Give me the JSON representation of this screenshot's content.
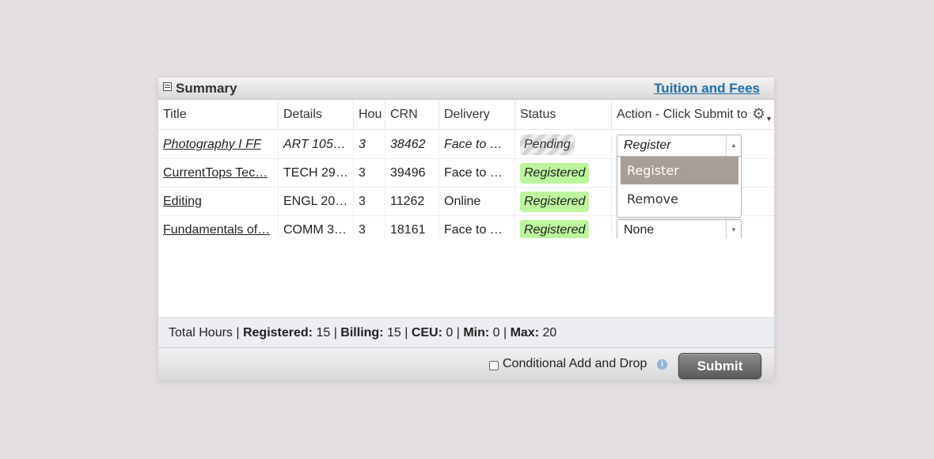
{
  "panel": {
    "title": "Summary",
    "tuition_link": "Tuition and Fees"
  },
  "columns": [
    "Title",
    "Details",
    "Hou",
    "CRN",
    "Delivery",
    "Status",
    "Action - Click Submit to"
  ],
  "rows": [
    {
      "title": "Photography I FF",
      "details": "ART 105…",
      "hours": "3",
      "crn": "38462",
      "delivery": "Face to …",
      "status": "Pending",
      "action": "Register",
      "pending": true
    },
    {
      "title": "CurrentTops Tec…",
      "details": "TECH 29…",
      "hours": "3",
      "crn": "39496",
      "delivery": "Face to …",
      "status": "Registered",
      "action": "",
      "pending": false
    },
    {
      "title": "Editing",
      "details": "ENGL 20…",
      "hours": "3",
      "crn": "11262",
      "delivery": "Online",
      "status": "Registered",
      "action": "",
      "pending": false
    },
    {
      "title": "Fundamentals of…",
      "details": "COMM 3…",
      "hours": "3",
      "crn": "18161",
      "delivery": "Face to …",
      "status": "Registered",
      "action": "None",
      "pending": false
    }
  ],
  "dropdown": {
    "options": [
      "Register",
      "Remove"
    ],
    "selected": "Register"
  },
  "totals": {
    "prefix": "Total Hours | ",
    "registered_label": "Registered:",
    "registered_value": " 15 | ",
    "billing_label": "Billing:",
    "billing_value": " 15 | ",
    "ceu_label": "CEU:",
    "ceu_value": " 0 | ",
    "min_label": "Min:",
    "min_value": " 0 | ",
    "max_label": "Max:",
    "max_value": " 20"
  },
  "footer": {
    "conditional_label": "Conditional Add and Drop",
    "submit_label": "Submit"
  },
  "colors": {
    "registered_badge": "#bdf59e",
    "link": "#1f6fa8",
    "dropdown_selected": "#a89e95"
  }
}
